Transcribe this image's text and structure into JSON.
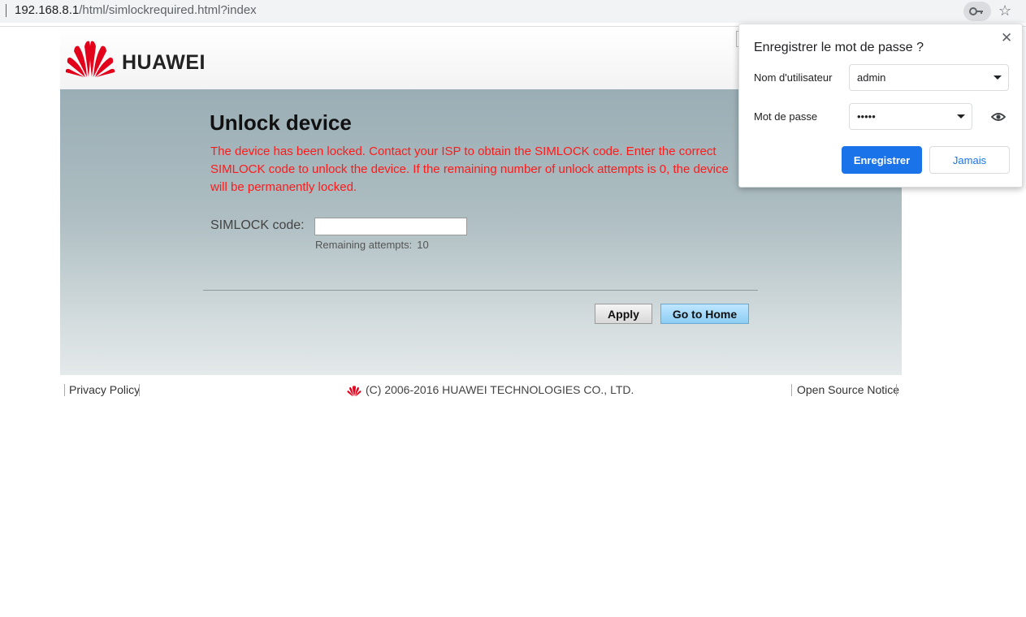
{
  "browser": {
    "url_host": "192.168.8.1",
    "url_path": "/html/simlockrequired.html?index",
    "icons": [
      "key-icon",
      "star-icon"
    ]
  },
  "header": {
    "brand": "HUAWEI"
  },
  "main": {
    "title": "Unlock device",
    "message": "The device has been locked. Contact your ISP to obtain the SIMLOCK code. Enter the correct SIMLOCK code to unlock the device. If the remaining number of unlock attempts is 0, the device will be permanently locked.",
    "simlock_label": "SIMLOCK code:",
    "simlock_value": "",
    "remaining_label": "Remaining attempts:",
    "remaining_value": "10",
    "apply_label": "Apply",
    "home_label": "Go to Home"
  },
  "footer": {
    "privacy": "Privacy Policy",
    "copyright": "(C) 2006-2016 HUAWEI TECHNOLOGIES CO., LTD.",
    "open_source": "Open Source Notice"
  },
  "password_popup": {
    "title": "Enregistrer le mot de passe ?",
    "username_label": "Nom d'utilisateur",
    "username_value": "admin",
    "password_label": "Mot de passe",
    "password_value": "•••••",
    "save_label": "Enregistrer",
    "never_label": "Jamais"
  },
  "colors": {
    "brand_red": "#e3001b",
    "warning_text": "#ff1a1a",
    "primary_button": "#1a73e8"
  }
}
